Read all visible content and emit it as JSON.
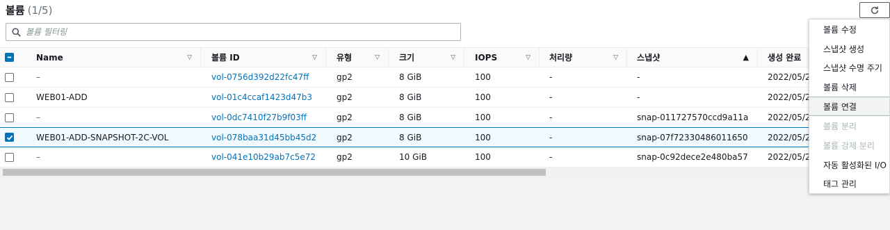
{
  "page": {
    "title": "볼륨",
    "count": "(1/5)"
  },
  "search": {
    "placeholder": "볼륨 필터링",
    "value": ""
  },
  "columns": [
    "Name",
    "볼륨 ID",
    "유형",
    "크기",
    "IOPS",
    "처리량",
    "스냅샷",
    "생성 완료"
  ],
  "rows": [
    {
      "name": "–",
      "volume_id": "vol-0756d392d22fc47ff",
      "type": "gp2",
      "size": "8 GiB",
      "iops": "100",
      "throughput": "-",
      "snapshot": "-",
      "created": "2022/05/2",
      "selected": false
    },
    {
      "name": "WEB01-ADD",
      "volume_id": "vol-01c4ccaf1423d47b3",
      "type": "gp2",
      "size": "8 GiB",
      "iops": "100",
      "throughput": "-",
      "snapshot": "-",
      "created": "2022/05/2",
      "selected": false
    },
    {
      "name": "–",
      "volume_id": "vol-0dc7410f27b9f03ff",
      "type": "gp2",
      "size": "8 GiB",
      "iops": "100",
      "throughput": "-",
      "snapshot": "snap-011727570ccd9a11a",
      "created": "2022/05/2",
      "selected": false
    },
    {
      "name": "WEB01-ADD-SNAPSHOT-2C-VOL",
      "volume_id": "vol-078baa31d45bb45d2",
      "type": "gp2",
      "size": "8 GiB",
      "iops": "100",
      "throughput": "-",
      "snapshot": "snap-07f72330486011650",
      "created": "2022/05/2",
      "selected": true
    },
    {
      "name": "–",
      "volume_id": "vol-041e10b29ab7c5e72",
      "type": "gp2",
      "size": "10 GiB",
      "iops": "100",
      "throughput": "-",
      "snapshot": "snap-0c92dece2e480ba57",
      "created": "2022/05/2",
      "selected": false
    }
  ],
  "actions_menu": {
    "items": [
      {
        "label": "볼륨 수정",
        "state": "enabled"
      },
      {
        "label": "스냅샷 생성",
        "state": "enabled"
      },
      {
        "label": "스냅샷 수명 주기",
        "state": "enabled"
      },
      {
        "label": "볼륨 삭제",
        "state": "enabled"
      },
      {
        "label": "볼륨 연결",
        "state": "active"
      },
      {
        "label": "볼륨 분리",
        "state": "disabled"
      },
      {
        "label": "볼륨 강제 분리",
        "state": "disabled"
      },
      {
        "label": "자동 활성화된 I/O",
        "state": "enabled"
      },
      {
        "label": "태그 관리",
        "state": "enabled"
      }
    ]
  },
  "icons": {
    "search": "search-icon",
    "refresh": "refresh-icon",
    "sort": "caret-down-icon",
    "sort_active": "caret-up-icon"
  },
  "colors": {
    "link": "#0073bb",
    "selected_bg": "#f1faff",
    "accent": "#0073bb"
  }
}
